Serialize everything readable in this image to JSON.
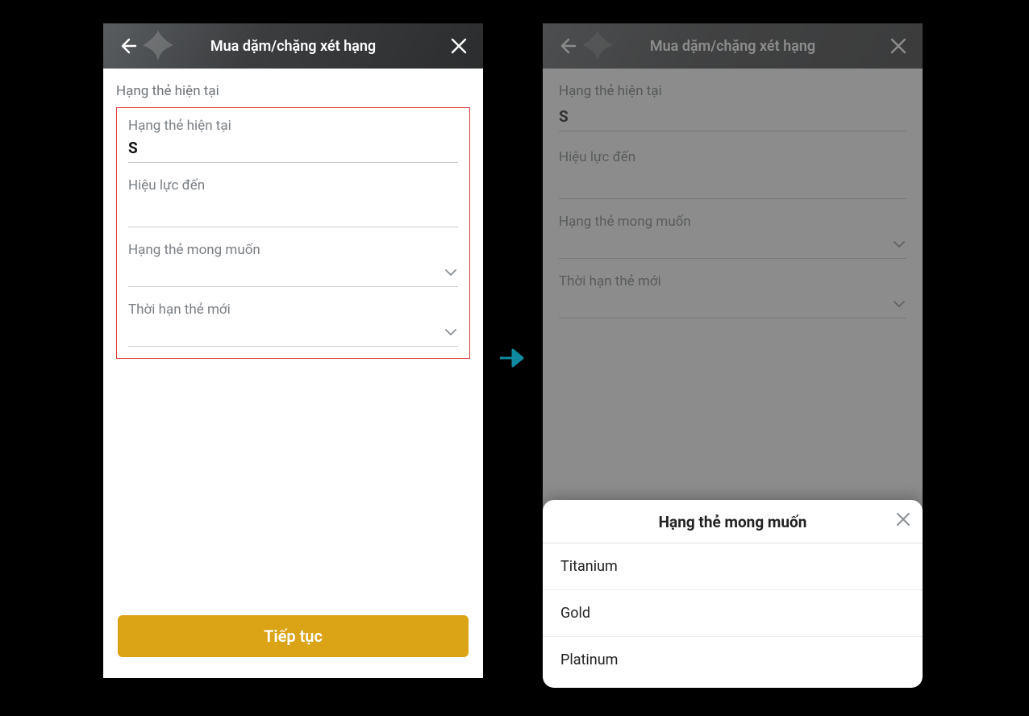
{
  "left": {
    "navbar": {
      "title": "Mua dặm/chặng xét hạng"
    },
    "section_label": "Hạng thẻ hiện tại",
    "fields": {
      "current_tier": {
        "label": "Hạng thẻ hiện tại",
        "value": "S"
      },
      "valid_until": {
        "label": "Hiệu lực đến",
        "value": ""
      },
      "desired_tier": {
        "label": "Hạng thẻ mong muốn",
        "value": ""
      },
      "new_expiry": {
        "label": "Thời hạn thẻ mới",
        "value": ""
      }
    },
    "cta": "Tiếp tục"
  },
  "right": {
    "navbar": {
      "title": "Mua dặm/chặng xét hạng"
    },
    "section_label": "Hạng thẻ hiện tại",
    "fields": {
      "current_tier_value": "S",
      "valid_until_label": "Hiệu lực đến",
      "desired_tier_label": "Hạng thẻ mong muốn",
      "new_expiry_label": "Thời hạn thẻ mới"
    },
    "sheet": {
      "title": "Hạng thẻ mong muốn",
      "options": [
        "Titanium",
        "Gold",
        "Platinum"
      ]
    }
  }
}
